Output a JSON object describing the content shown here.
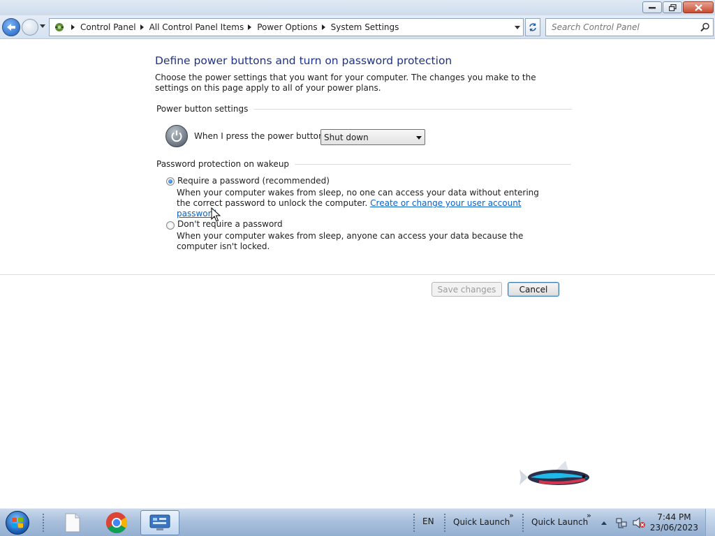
{
  "address_bar": {
    "breadcrumbs": [
      "Control Panel",
      "All Control Panel Items",
      "Power Options",
      "System Settings"
    ],
    "search_placeholder": "Search Control Panel"
  },
  "page": {
    "title": "Define power buttons and turn on password protection",
    "description": "Choose the power settings that you want for your computer. The changes you make to the settings on this page apply to all of your power plans.",
    "power_section": {
      "heading": "Power button settings",
      "power_button_label": "When I press the power button:",
      "power_button_value": "Shut down"
    },
    "password_section": {
      "heading": "Password protection on wakeup",
      "require": {
        "label": "Require a password (recommended)",
        "description": "When your computer wakes from sleep, no one can access your data without entering the correct password to unlock the computer.",
        "link": "Create or change your user account password",
        "selected": true
      },
      "dont_require": {
        "label": "Don't require a password",
        "description": "When your computer wakes from sleep, anyone can access your data because the computer isn't locked.",
        "selected": false
      }
    },
    "buttons": {
      "save": "Save changes",
      "cancel": "Cancel"
    }
  },
  "taskbar": {
    "language": "EN",
    "quick_launch_1": "Quick Launch",
    "quick_launch_2": "Quick Launch",
    "time": "7:44 PM",
    "date": "23/06/2023"
  }
}
